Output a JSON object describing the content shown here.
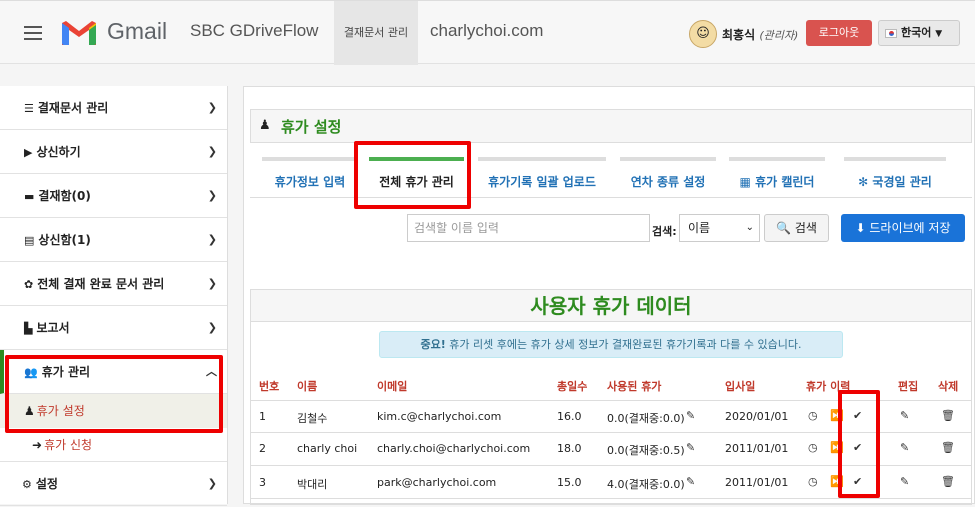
{
  "header": {
    "brand": "Gmail",
    "app_name": "SBC GDriveFlow",
    "nav_active": "결재문서 관리",
    "domain": "charlychoi.com",
    "user_name": "최홍식",
    "user_role": "(관리자)",
    "logout_label": "로그아웃",
    "language": "한국어",
    "colors": {
      "logout": "#d9534f",
      "drive_button": "#1a73d8",
      "title_green": "#2e8b1f"
    }
  },
  "sidebar": {
    "items": [
      {
        "icon": "list-icon",
        "label": "결재문서 관리"
      },
      {
        "icon": "caret-right-icon",
        "label": "상신하기"
      },
      {
        "icon": "inbox-icon",
        "label": "결재함(0)"
      },
      {
        "icon": "list-box-icon",
        "label": "상신함(1)"
      },
      {
        "icon": "gear-icon",
        "label": "전체 결재 완료 문서 관리"
      },
      {
        "icon": "document-icon",
        "label": "보고서"
      },
      {
        "icon": "users-icon",
        "label": "휴가 관리"
      }
    ],
    "sub_items": [
      {
        "icon": "user-icon",
        "label": "휴가 설정"
      },
      {
        "icon": "sign-in-icon",
        "label": "휴가 신청"
      }
    ],
    "last_item": {
      "icon": "cog-icon",
      "label": "설정"
    }
  },
  "panel": {
    "title": "휴가 설정",
    "tabs": [
      "휴가정보 입력",
      "전체 휴가 관리",
      "휴가기록 일괄 업로드",
      "연차 종류 설정",
      "휴가 캘린더",
      "국경일 관리"
    ],
    "search_placeholder": "검색할 이름 입력",
    "search_label": "검색:",
    "search_by": "이름",
    "search_button": "검색",
    "drive_button": "드라이브에 저장"
  },
  "data_section": {
    "title": "사용자 휴가 데이터",
    "notice_bold": "중요!",
    "notice_text": "휴가 리셋 후에는 휴가 상세 정보가 결재완료된 휴가기록과 다를 수 있습니다.",
    "columns": [
      "번호",
      "이름",
      "이메일",
      "총일수",
      "사용된 휴가",
      "입사일",
      "휴가 이력",
      "편집",
      "삭제"
    ],
    "rows": [
      {
        "no": "1",
        "name": "김철수",
        "email": "kim.c@charlychoi.com",
        "total": "16.0",
        "used": "0.0(결재중:0.0)",
        "joined": "2020/01/01"
      },
      {
        "no": "2",
        "name": "charly choi",
        "email": "charly.choi@charlychoi.com",
        "total": "18.0",
        "used": "0.0(결재중:0.5)",
        "joined": "2011/01/01"
      },
      {
        "no": "3",
        "name": "박대리",
        "email": "park@charlychoi.com",
        "total": "15.0",
        "used": "4.0(결재중:0.0)",
        "joined": "2011/01/01"
      }
    ]
  }
}
